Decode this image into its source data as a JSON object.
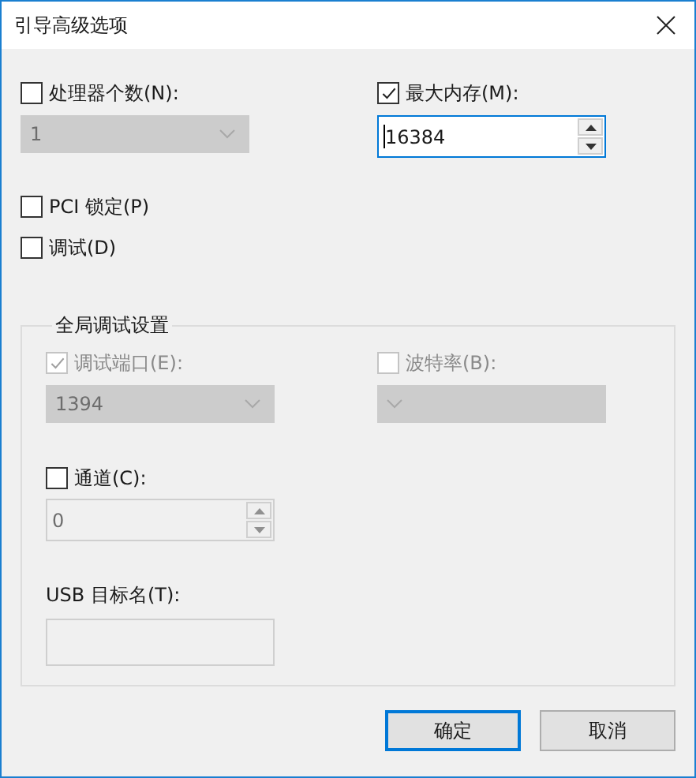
{
  "window": {
    "title": "引导高级选项"
  },
  "processor_count": {
    "label": "处理器个数(N):",
    "checked": false,
    "value": "1",
    "disabled": true
  },
  "max_memory": {
    "label": "最大内存(M):",
    "checked": true,
    "value": "16384",
    "focused": true
  },
  "pci_lock": {
    "label": "PCI 锁定(P)",
    "checked": false
  },
  "debug": {
    "label": "调试(D)",
    "checked": false
  },
  "global_debug": {
    "title": "全局调试设置",
    "debug_port": {
      "label": "调试端口(E):",
      "checked": true,
      "disabled": true,
      "value": "1394"
    },
    "baud_rate": {
      "label": "波特率(B):",
      "checked": false,
      "disabled": true
    },
    "channel": {
      "label": "通道(C):",
      "checked": false,
      "disabled": true,
      "value": "0"
    },
    "usb_target": {
      "label": "USB 目标名(T):",
      "disabled": true
    }
  },
  "buttons": [
    {
      "label": "确定",
      "default": true
    },
    {
      "label": "取消",
      "default": false
    }
  ]
}
